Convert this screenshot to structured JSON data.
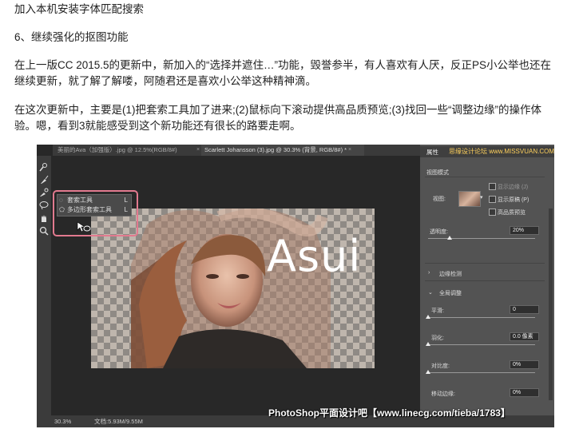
{
  "article": {
    "line1": "加入本机安装字体匹配搜索",
    "line2": "6、继续强化的抠图功能",
    "para1a": "在上一版CC 2015.5的更新中，新加入的“选择并遮住…”功能，毁誉参半，有人喜欢有人厌，反正PS小公举也还在",
    "para1b": "继续更新，就了解了解喽，阿随君还是喜欢小公举这种精神滴。",
    "para2a": "在这次更新中，主要是(1)把套索工具加了进来;(2)鼠标向下滚动提供高品质预览;(3)找回一些“调整边缘”的操作体",
    "para2b": "验。嗯，看到3就能感受到这个新功能还有很长的路要走啊。"
  },
  "photoshop": {
    "tabs": [
      {
        "label": "美丽的Ava（加强版）.jpg @ 12.5%(RGB/8#)",
        "close": "×"
      },
      {
        "label": "Scarlett Johansson (3).jpg @ 30.3% (背景, RGB/8#) *",
        "close": "×"
      }
    ],
    "tool_menu": [
      {
        "label": "套索工具",
        "key": "L"
      },
      {
        "label": "多边形套索工具",
        "key": "L"
      }
    ],
    "canvas_text": "Asui",
    "panel": {
      "title": "属性",
      "site_tag": "思缘设计论坛 www.MISSVUAN.COM",
      "view_mode_section": "视图模式",
      "view_label": "视图:",
      "show_edge": "显示边缘 (J)",
      "show_original": "显示原稿 (P)",
      "hq_preview": "高品质预览",
      "transparency_label": "透明度:",
      "transparency_value": "20%",
      "transparency_fraction": 0.2,
      "edge_detection": "边缘检测",
      "global_adjust": "全局调整",
      "smooth_label": "平滑:",
      "smooth_value": "0",
      "feather_label": "羽化:",
      "feather_value": "0.0 像素",
      "contrast_label": "对比度:",
      "contrast_value": "0%",
      "shift_edge_label": "移动边缘:",
      "shift_edge_value": "0%"
    },
    "status": {
      "zoom": "30.3%",
      "doc": "文档:5.93M/9.55M"
    },
    "watermark": "PhotoShop平面设计吧【www.linecg.com/tieba/1783】",
    "accent": "#e27a8f"
  }
}
